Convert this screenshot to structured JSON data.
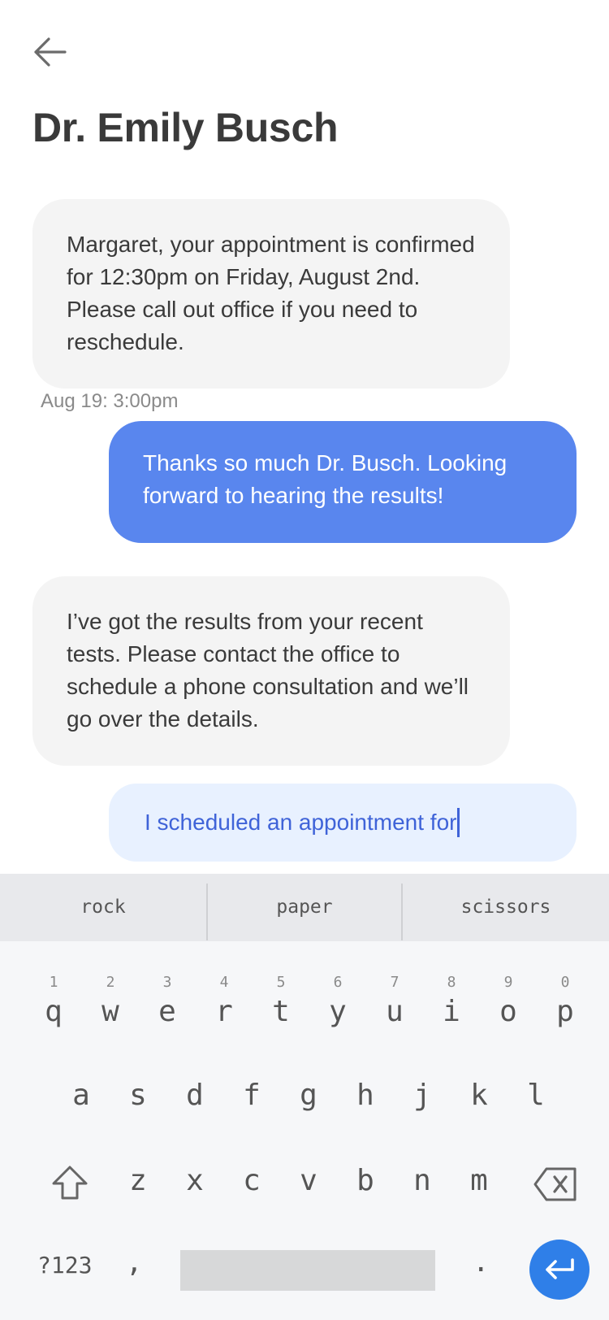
{
  "header": {
    "title": "Dr. Emily Busch",
    "back_icon": "arrow-left-icon"
  },
  "messages": [
    {
      "sender": "doctor",
      "text": "Margaret, your appointment is confirmed for 12:30pm on Friday, August 2nd. Please call out office if you need to reschedule.",
      "timestamp": "Aug 19: 3:00pm"
    },
    {
      "sender": "me",
      "text": "Thanks so much Dr. Busch. Looking forward to hearing the results!"
    },
    {
      "sender": "doctor",
      "text": "I’ve got the results from your recent tests. Please contact the office to schedule a phone consultation and we’ll go over the details."
    }
  ],
  "composer": {
    "value": "I scheduled an appointment for"
  },
  "keyboard": {
    "suggestions": [
      "rock",
      "paper",
      "scissors"
    ],
    "row1": [
      {
        "hint": "1",
        "key": "q"
      },
      {
        "hint": "2",
        "key": "w"
      },
      {
        "hint": "3",
        "key": "e"
      },
      {
        "hint": "4",
        "key": "r"
      },
      {
        "hint": "5",
        "key": "t"
      },
      {
        "hint": "6",
        "key": "y"
      },
      {
        "hint": "7",
        "key": "u"
      },
      {
        "hint": "8",
        "key": "i"
      },
      {
        "hint": "9",
        "key": "o"
      },
      {
        "hint": "0",
        "key": "p"
      }
    ],
    "row2": [
      "a",
      "s",
      "d",
      "f",
      "g",
      "h",
      "j",
      "k",
      "l"
    ],
    "row3": [
      "z",
      "x",
      "c",
      "v",
      "b",
      "n",
      "m"
    ],
    "symbols_label": "?123",
    "comma": ",",
    "period": ".",
    "shift_icon": "shift-icon",
    "backspace_icon": "backspace-icon",
    "enter_icon": "enter-icon"
  },
  "colors": {
    "accent": "#5986ee",
    "composer_bg": "#e8f1ff",
    "enter_button": "#2f7fe8"
  }
}
